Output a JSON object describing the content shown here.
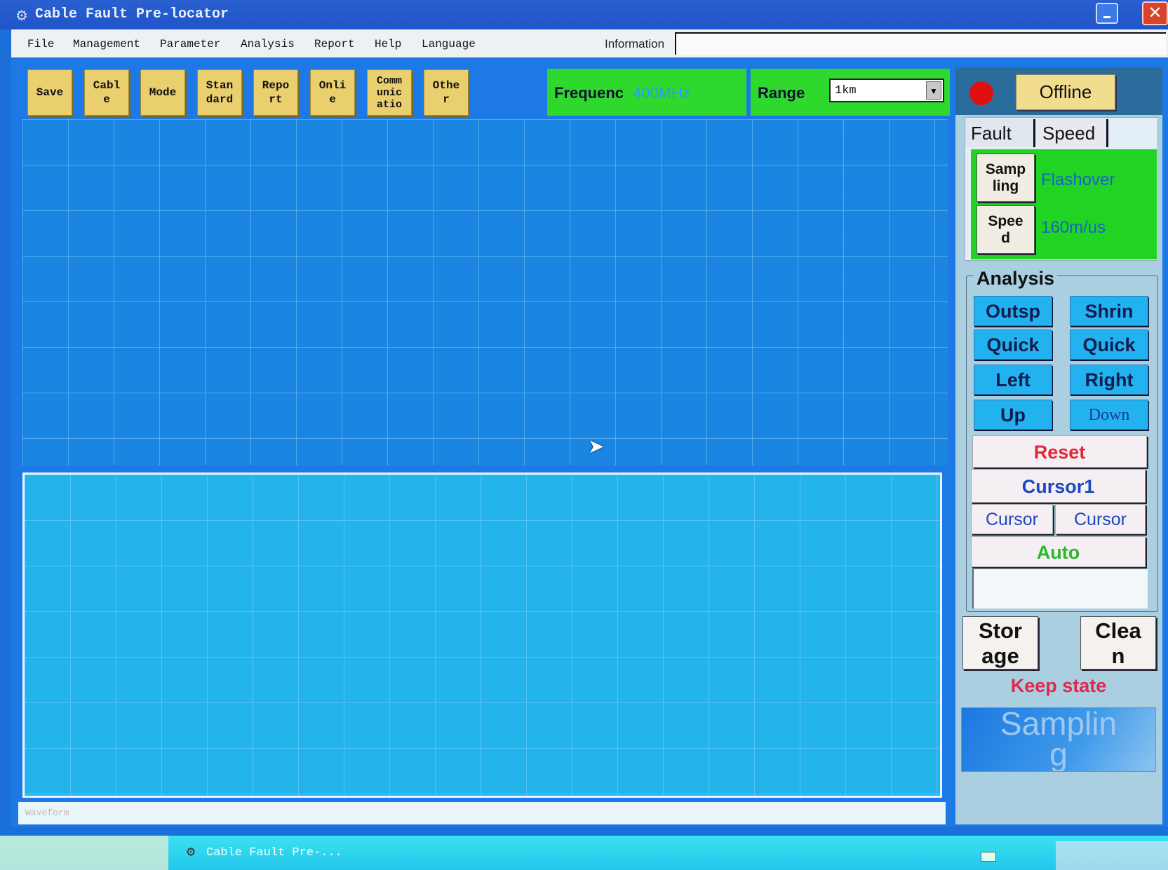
{
  "window": {
    "title": "Cable Fault Pre-locator",
    "close_glyph": "✕"
  },
  "menu": [
    "File",
    "Management",
    "Parameter",
    "Analysis",
    "Report",
    "Help",
    "Language"
  ],
  "information": {
    "label": "Information",
    "value": ""
  },
  "toolbar": [
    "Save",
    "Cabl\ne",
    "Mode",
    "Stan\ndard",
    "Repo\nrt",
    "Onli\ne",
    "Comm\nunic\natio",
    "Othe\nr"
  ],
  "frequency": {
    "label": "Frequenc",
    "value": "400MHz"
  },
  "range": {
    "label": "Range",
    "value": "1km"
  },
  "status": {
    "led_color": "#e01010",
    "offline_label": "Offline"
  },
  "tabs": {
    "fault": "Fault",
    "speed": "Speed"
  },
  "fault_panel": {
    "sampling_btn": "Samp\nling",
    "sampling_value": "Flashover",
    "speed_btn": "Spee\nd",
    "speed_value": "160m/us"
  },
  "analysis": {
    "title": "Analysis",
    "buttons": [
      "Outsp",
      "Shrin",
      "Quick",
      "Quick",
      "Left",
      "Right",
      "Up",
      "Down"
    ],
    "reset": "Reset",
    "cursor1": "Cursor1",
    "cursor_left": "Cursor",
    "cursor_right": "Cursor",
    "auto": "Auto"
  },
  "storage": "Stor\nage",
  "clean": "Clea\nn",
  "keep_state": "Keep state",
  "sampling": "Samplin\ng",
  "waveform_label": "Waveform",
  "taskbar": {
    "task": "Cable Fault Pre-..."
  }
}
